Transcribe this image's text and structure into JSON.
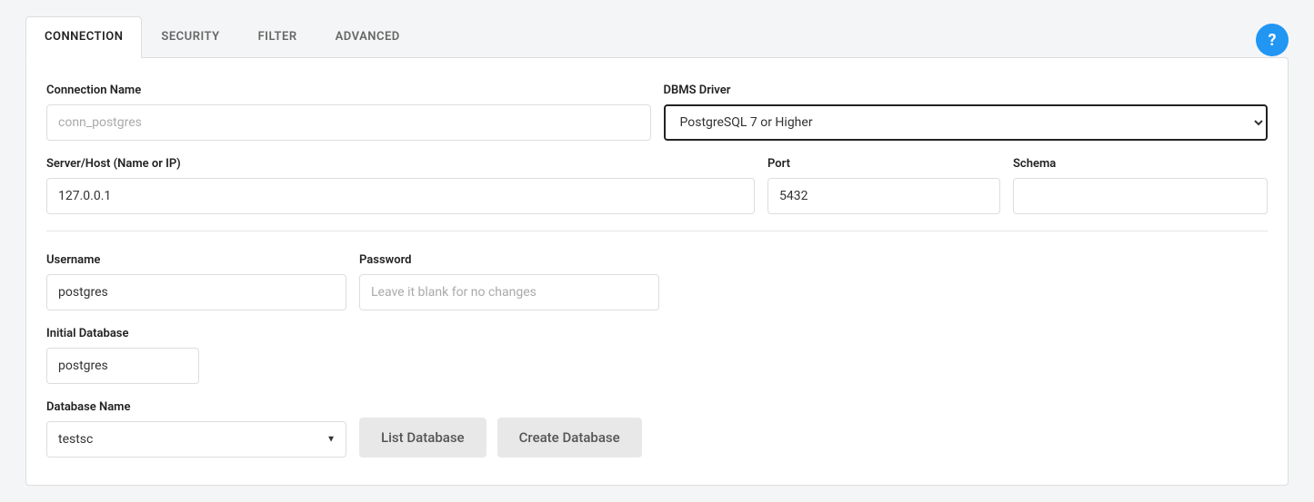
{
  "tabs": {
    "connection": "CONNECTION",
    "security": "SECURITY",
    "filter": "FILTER",
    "advanced": "ADVANCED"
  },
  "help_icon": "?",
  "fields": {
    "connection_name": {
      "label": "Connection Name",
      "placeholder": "conn_postgres",
      "value": ""
    },
    "dbms_driver": {
      "label": "DBMS Driver",
      "selected": "PostgreSQL 7 or Higher"
    },
    "server_host": {
      "label": "Server/Host (Name or IP)",
      "value": "127.0.0.1"
    },
    "port": {
      "label": "Port",
      "value": "5432"
    },
    "schema": {
      "label": "Schema",
      "value": ""
    },
    "username": {
      "label": "Username",
      "value": "postgres"
    },
    "password": {
      "label": "Password",
      "placeholder": "Leave it blank for no changes",
      "value": ""
    },
    "initial_database": {
      "label": "Initial Database",
      "value": "postgres"
    },
    "database_name": {
      "label": "Database Name",
      "value": "testsc"
    }
  },
  "buttons": {
    "list_database": "List Database",
    "create_database": "Create Database"
  }
}
